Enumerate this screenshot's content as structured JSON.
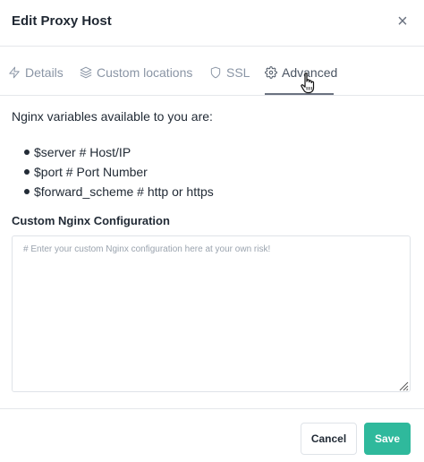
{
  "modal": {
    "title": "Edit Proxy Host",
    "close_label": "×"
  },
  "tabs": [
    {
      "label": "Details",
      "icon": "zap-icon"
    },
    {
      "label": "Custom locations",
      "icon": "layers-icon"
    },
    {
      "label": "SSL",
      "icon": "shield-icon"
    },
    {
      "label": "Advanced",
      "icon": "gear-icon",
      "active": true
    }
  ],
  "advanced": {
    "intro": "Nginx variables available to you are:",
    "variables": [
      "$server # Host/IP",
      "$port # Port Number",
      "$forward_scheme # http or https"
    ],
    "config_label": "Custom Nginx Configuration",
    "config_value": "",
    "config_placeholder": "# Enter your custom Nginx configuration here at your own risk!"
  },
  "footer": {
    "cancel_label": "Cancel",
    "save_label": "Save"
  },
  "colors": {
    "accent": "#2fb99c",
    "text": "#222b36",
    "muted": "#8a95a5",
    "border": "#e5e7eb"
  }
}
